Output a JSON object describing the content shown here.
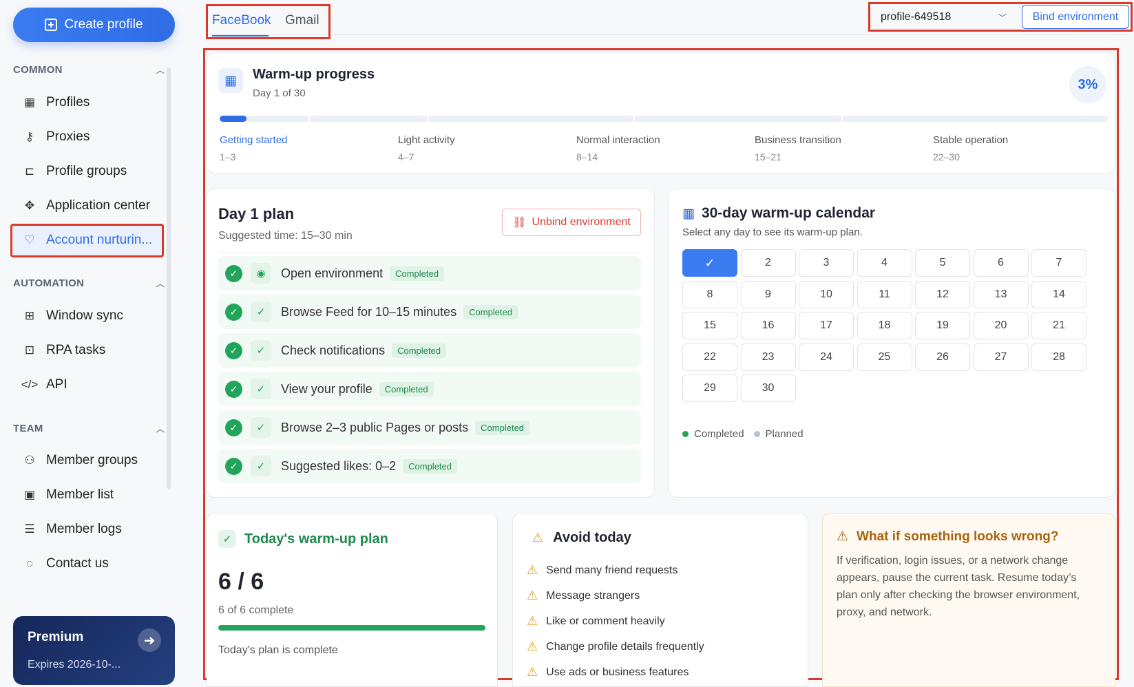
{
  "sidebar": {
    "create_label": "Create profile",
    "sections": [
      {
        "title": "COMMON",
        "items": [
          {
            "label": "Profiles",
            "icon": "grid-icon"
          },
          {
            "label": "Proxies",
            "icon": "network-icon"
          },
          {
            "label": "Profile groups",
            "icon": "tree-icon"
          },
          {
            "label": "Application center",
            "icon": "puzzle-icon"
          },
          {
            "label": "Account nurturin...",
            "icon": "heart-pulse-icon",
            "active": true
          }
        ]
      },
      {
        "title": "AUTOMATION",
        "items": [
          {
            "label": "Window sync",
            "icon": "window-grid-icon"
          },
          {
            "label": "RPA tasks",
            "icon": "robot-icon"
          },
          {
            "label": "API",
            "icon": "code-icon"
          }
        ]
      },
      {
        "title": "TEAM",
        "items": [
          {
            "label": "Member groups",
            "icon": "users-icon"
          },
          {
            "label": "Member list",
            "icon": "id-card-icon"
          },
          {
            "label": "Member logs",
            "icon": "clipboard-icon"
          },
          {
            "label": "Contact us",
            "icon": "chat-icon"
          }
        ]
      }
    ],
    "premium": {
      "title": "Premium",
      "expires": "Expires 2026-10-..."
    }
  },
  "tabs": [
    "FaceBook",
    "Gmail"
  ],
  "env": {
    "selected": "profile-649518",
    "bind_label": "Bind environment"
  },
  "warmup": {
    "title": "Warm-up progress",
    "subtitle": "Day 1 of 30",
    "percent_label": "3%",
    "progress": 0.03,
    "phases": [
      {
        "name": "Getting started",
        "range": "1–3"
      },
      {
        "name": "Light activity",
        "range": "4–7"
      },
      {
        "name": "Normal interaction",
        "range": "8–14"
      },
      {
        "name": "Business transition",
        "range": "15–21"
      },
      {
        "name": "Stable operation",
        "range": "22–30"
      }
    ]
  },
  "plan": {
    "title": "Day 1 plan",
    "subtitle": "Suggested time: 15–30 min",
    "unbind_label": "Unbind environment",
    "tasks": [
      {
        "text": "Open environment",
        "status": "Completed"
      },
      {
        "text": "Browse Feed for 10–15 minutes",
        "status": "Completed"
      },
      {
        "text": "Check notifications",
        "status": "Completed"
      },
      {
        "text": "View your profile",
        "status": "Completed"
      },
      {
        "text": "Browse 2–3 public Pages or posts",
        "status": "Completed"
      },
      {
        "text": "Suggested likes: 0–2",
        "status": "Completed"
      }
    ]
  },
  "calendar": {
    "title": "30-day warm-up calendar",
    "subtitle": "Select any day to see its warm-up plan.",
    "completed_days": [
      1
    ],
    "legend": {
      "completed": "Completed",
      "planned": "Planned"
    },
    "colors": {
      "completed": "#22a55a",
      "planned": "#b8c2d4"
    }
  },
  "today": {
    "title": "Today's warm-up plan",
    "count": "6 / 6",
    "sub": "6 of 6 complete",
    "progress": 1.0,
    "note": "Today's plan is complete"
  },
  "avoid": {
    "title": "Avoid today",
    "items": [
      "Send many friend requests",
      "Message strangers",
      "Like or comment heavily",
      "Change profile details frequently",
      "Use ads or business features"
    ]
  },
  "wrong": {
    "title": "What if something looks wrong?",
    "text": "If verification, login issues, or a network change appears, pause the current task. Resume today’s plan only after checking the browser environment, proxy, and network."
  },
  "colors": {
    "accent": "#2f6de6",
    "success": "#22a55a",
    "warning": "#e0a020",
    "highlight": "#d93a2b"
  }
}
